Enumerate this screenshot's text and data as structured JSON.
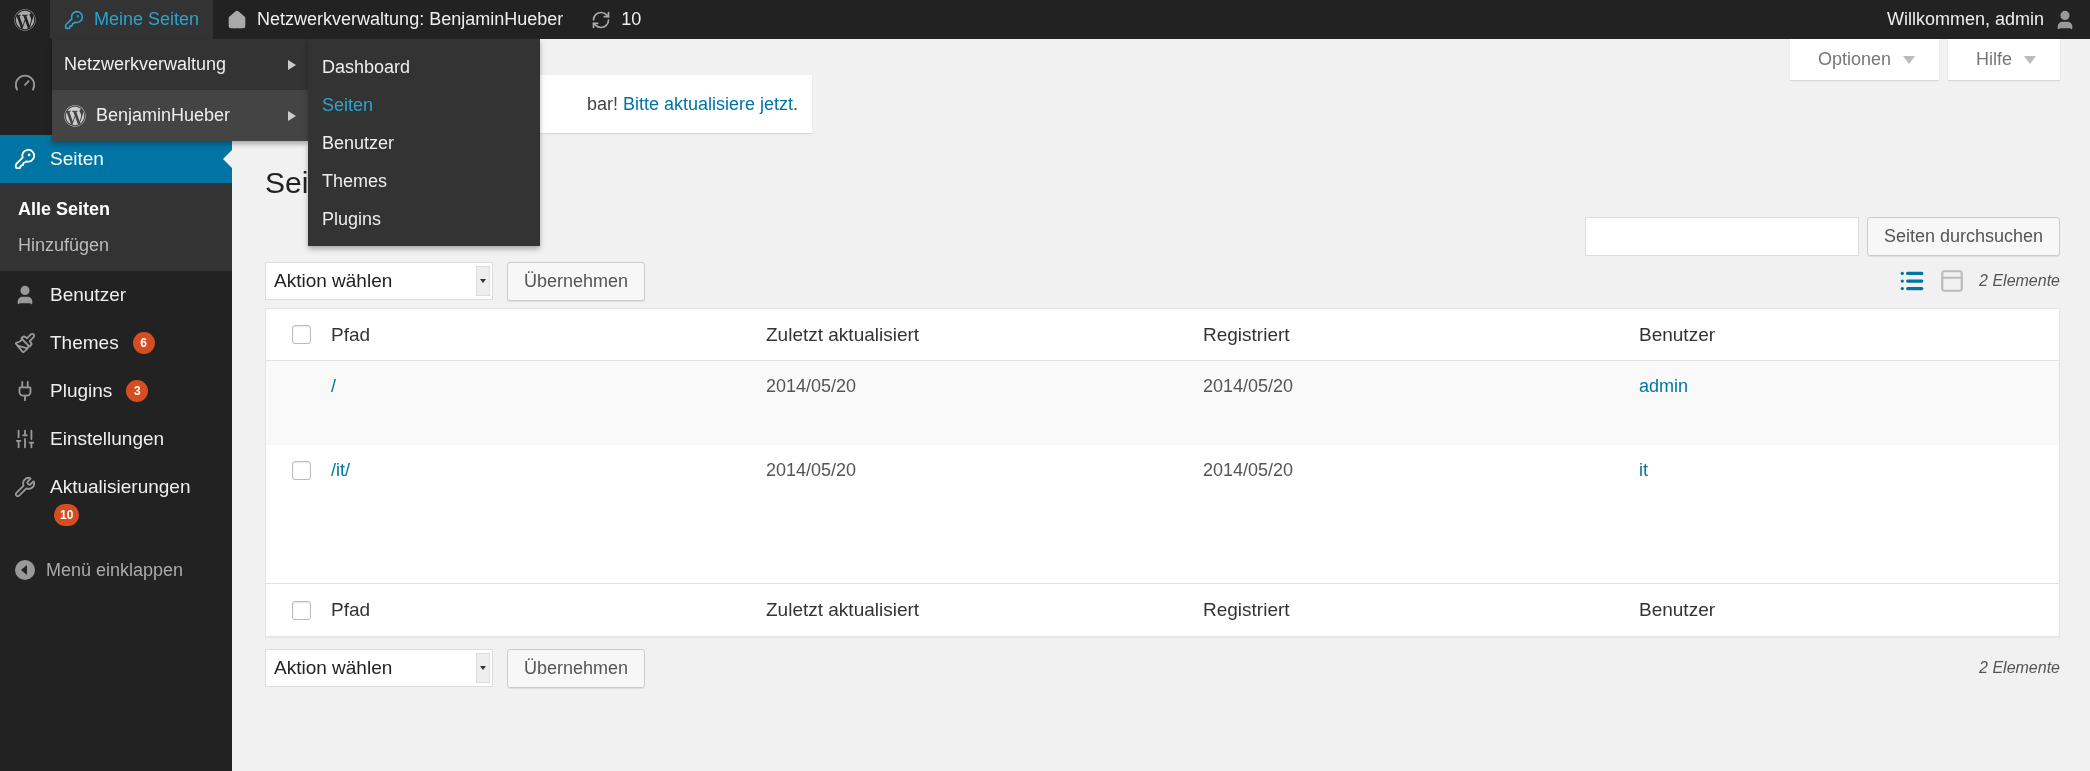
{
  "admin_bar": {
    "items": [
      {
        "kind": "logo",
        "selected": false
      },
      {
        "kind": "my_sites",
        "label": "Meine Seiten",
        "selected": true
      },
      {
        "kind": "site",
        "label": "Netzwerkverwaltung: BenjaminHueber",
        "selected": false
      },
      {
        "kind": "updates",
        "label": "10",
        "selected": false
      }
    ],
    "greeting": "Willkommen, admin"
  },
  "my_sites_menu": {
    "items": [
      {
        "kind": "network",
        "label": "Netzwerkverwaltung",
        "selected": false
      },
      {
        "kind": "site",
        "label": "BenjaminHueber",
        "selected": true
      }
    ],
    "submenu": [
      {
        "label": "Dashboard",
        "selected": false
      },
      {
        "label": "Seiten",
        "selected": true
      },
      {
        "label": "Benutzer",
        "selected": false
      },
      {
        "label": "Themes",
        "selected": false
      },
      {
        "label": "Plugins",
        "selected": false
      }
    ]
  },
  "sidebar": {
    "items": [
      {
        "kind": "dashboard",
        "selected": false
      },
      {
        "kind": "pages",
        "label": "Seiten",
        "selected": true,
        "children": [
          {
            "label": "Alle Seiten",
            "selected": true
          },
          {
            "label": "Hinzufügen",
            "selected": false
          }
        ]
      },
      {
        "kind": "users",
        "label": "Benutzer",
        "selected": false
      },
      {
        "kind": "themes",
        "label": "Themes",
        "badge": "6",
        "selected": false
      },
      {
        "kind": "plugins",
        "label": "Plugins",
        "badge": "3",
        "selected": false
      },
      {
        "kind": "settings",
        "label": "Einstellungen",
        "selected": false
      },
      {
        "kind": "updates",
        "label": "Aktualisierungen",
        "badge": "10",
        "selected": false
      }
    ],
    "collapse": "Menü einklappen"
  },
  "screen_tabs": [
    {
      "label": "Optionen"
    },
    {
      "label": "Hilfe"
    }
  ],
  "notice": {
    "text": "bar! ",
    "link": "Bitte aktualisiere jetzt",
    "tail": "."
  },
  "heading": "Sei",
  "search": {
    "button": "Seiten durchsuchen"
  },
  "top_nav": {
    "bulk_action": "Aktion wählen",
    "apply": "Übernehmen",
    "view_modes": [
      {
        "kind": "list",
        "selected": true
      },
      {
        "kind": "excerpt",
        "selected": false
      }
    ],
    "count": "2 Elemente"
  },
  "table": {
    "columns": [
      "Pfad",
      "Zuletzt aktualisiert",
      "Registriert",
      "Benutzer"
    ],
    "select_all_checked": false,
    "rows": [
      {
        "path": "/",
        "updated": "2014/05/20",
        "registered": "2014/05/20",
        "user": "admin",
        "has_checkbox": false
      },
      {
        "path": "/it/",
        "updated": "2014/05/20",
        "registered": "2014/05/20",
        "user": "it",
        "has_checkbox": true,
        "checked": false
      }
    ],
    "footer_columns": [
      "Pfad",
      "Zuletzt aktualisiert",
      "Registriert",
      "Benutzer"
    ],
    "footer_select_all_checked": false
  },
  "bottom_nav": {
    "bulk_action": "Aktion wählen",
    "apply": "Übernehmen",
    "count": "2 Elemente"
  }
}
